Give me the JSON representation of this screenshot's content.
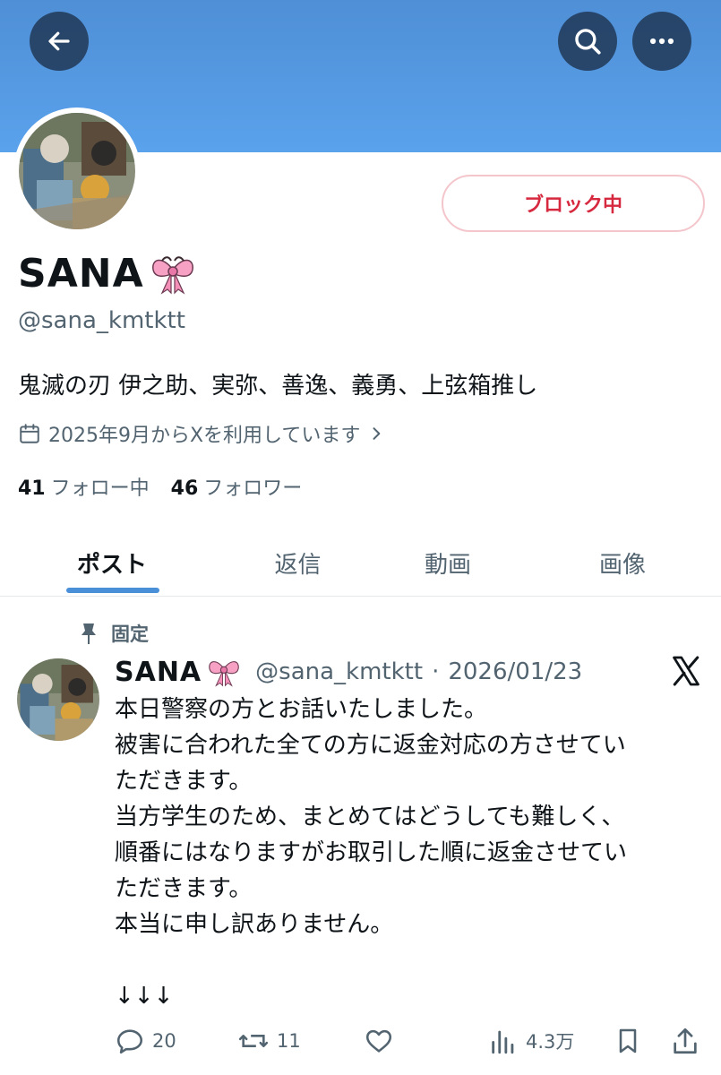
{
  "header": {
    "back_icon": "arrow-left-icon",
    "search_icon": "search-icon",
    "more_icon": "more-horizontal-icon"
  },
  "profile": {
    "display_name": "SANA",
    "name_emoji": "ribbon-emoji",
    "handle": "@sana_kmtktt",
    "block_button": "ブロック中",
    "bio": "鬼滅の刃 伊之助、実弥、善逸、義勇、上弦箱推し",
    "joined": "2025年9月からXを利用しています",
    "following_count": "41",
    "following_label": "フォロー中",
    "followers_count": "46",
    "followers_label": "フォロワー"
  },
  "tabs": [
    {
      "label": "ポスト",
      "active": true
    },
    {
      "label": "返信",
      "active": false
    },
    {
      "label": "動画",
      "active": false
    },
    {
      "label": "画像",
      "active": false
    }
  ],
  "accent_color": "#4a90d9",
  "block_color": "#d6293f",
  "post": {
    "pinned_label": "固定",
    "name": "SANA",
    "handle": "@sana_kmtktt",
    "separator": "·",
    "date": "2026/01/23",
    "body": "本日警察の方とお話いたしました。\n被害に合われた全ての方に返金対応の方させてい\nただきます。\n当方学生のため、まとめてはどうしても難しく、\n順番にはなりますがお取引した順に返金させてい\nただきます。\n本当に申し訳ありません。\n\n↓↓↓",
    "replies": "20",
    "reposts": "11",
    "views": "4.3万"
  }
}
